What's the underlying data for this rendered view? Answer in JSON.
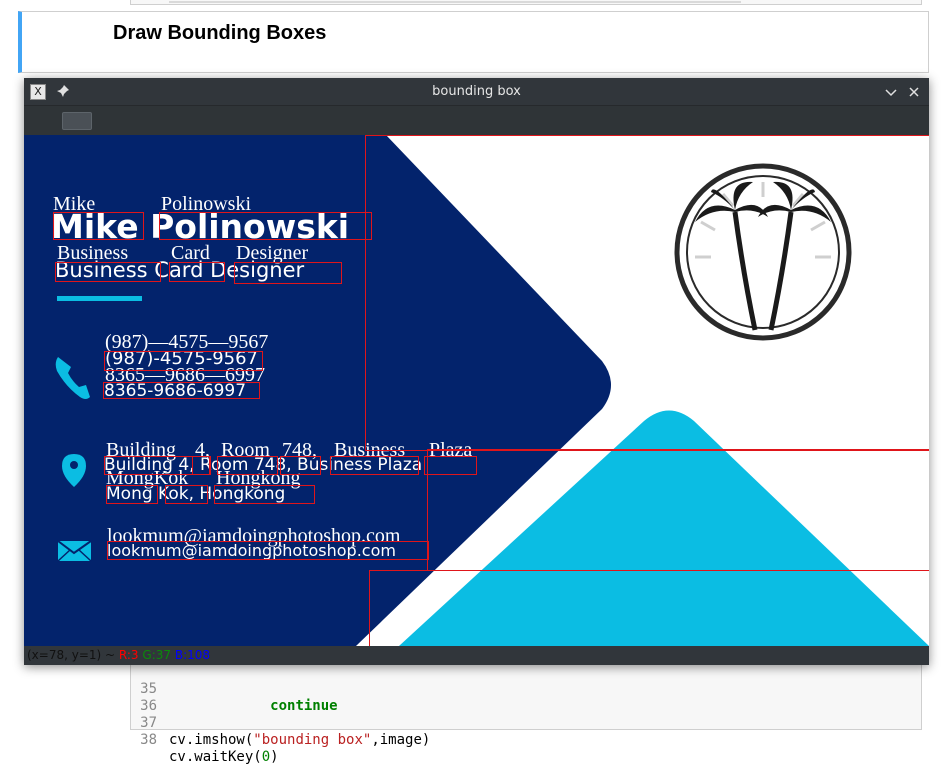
{
  "notebook": {
    "markdown_heading": "Draw Bounding Boxes",
    "code_lines": [
      {
        "num": "35",
        "indent": "            ",
        "kw": "continue",
        "pre": "",
        "str": "",
        "post": "",
        "numlit": "",
        "end": ""
      },
      {
        "num": "36",
        "indent": "",
        "kw": "",
        "pre": "",
        "str": "",
        "post": "",
        "numlit": "",
        "end": ""
      },
      {
        "num": "37",
        "indent": "",
        "kw": "",
        "pre": "cv.imshow(",
        "str": "\"bounding box\"",
        "post": ",image)",
        "numlit": "",
        "end": ""
      },
      {
        "num": "38",
        "indent": "",
        "kw": "",
        "pre": "cv.waitKey(",
        "str": "",
        "post": "",
        "numlit": "0",
        "end": ")"
      }
    ]
  },
  "window": {
    "title": "bounding box",
    "app_icon_glyph": "X",
    "pin_icon": "pin-icon",
    "minimize_icon": "chevron-down-icon",
    "close_icon": "close-icon",
    "status": {
      "coords": "(x=78, y=1) ~ ",
      "r": "R:3",
      "g": "G:37",
      "b": "B:108"
    }
  },
  "card": {
    "name": "Mike Polinowski",
    "title": "Business Card Designer",
    "phone1": "(987)-4575-9567",
    "phone2": "8365-9686-6997",
    "address1": "Building 4, Room 748, Business Plaza",
    "address2": "Mong Kok, Hongkong",
    "email": "lookmum@iamdoingphotoshop.com",
    "colors": {
      "navy": "#03236c",
      "cyan": "#0bbde3",
      "white": "#ffffff",
      "bbox": "#e0151a"
    }
  },
  "ocr": {
    "name_first": "Mike",
    "name_last": "Polinowski",
    "title_words": [
      "Business",
      "Card",
      "Designer"
    ],
    "phone1": "(987)—4575—9567",
    "phone2": "8365—9686—6997",
    "addr_building": "Building",
    "addr_4": "4,",
    "addr_room": "Room",
    "addr_748": "748,",
    "addr_business": "Business",
    "addr_plaza": "Plaza",
    "addr_mongkok": "MongKok",
    "addr_hongkong": "Hongkong",
    "email": "lookmum@iamdoingphotoshop.com"
  }
}
